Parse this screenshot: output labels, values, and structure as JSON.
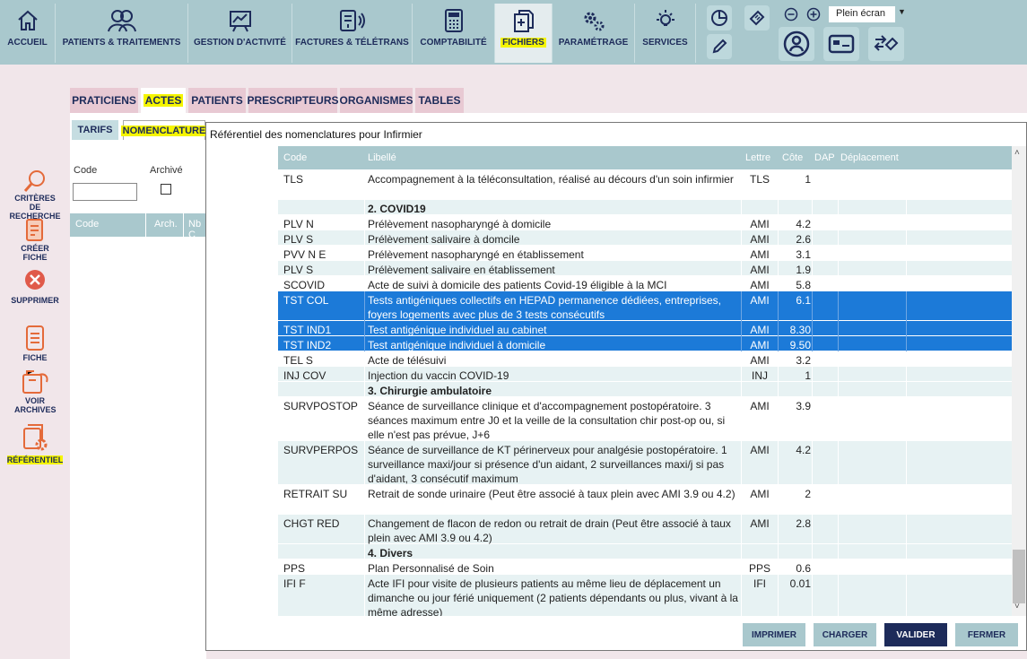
{
  "nav": {
    "items": [
      {
        "label": "ACCUEIL",
        "icon": "home-icon"
      },
      {
        "label": "PATIENTS & TRAITEMENTS",
        "icon": "users-icon"
      },
      {
        "label": "GESTION D'ACTIVITÉ",
        "icon": "chart-board-icon"
      },
      {
        "label": "FACTURES & TÉLÉTRANS",
        "icon": "invoice-transmit-icon"
      },
      {
        "label": "COMPTABILITÉ",
        "icon": "calculator-icon"
      },
      {
        "label": "FICHIERS",
        "icon": "files-icon"
      },
      {
        "label": "PARAMÉTRAGE",
        "icon": "gears-icon"
      },
      {
        "label": "SERVICES",
        "icon": "bulb-icon"
      }
    ],
    "fullscreen": "Plein écran"
  },
  "tabs": [
    "PRATICIENS",
    "ACTES",
    "PATIENTS",
    "PRESCRIPTEURS",
    "ORGANISMES",
    "TABLES"
  ],
  "subtabs": [
    "TARIFS",
    "NOMENCLATURE"
  ],
  "sidebar": [
    {
      "label": "CRITÈRES DE RECHERCHE",
      "icon": "search-icon"
    },
    {
      "label": "CRÉER FICHE",
      "icon": "new-file-icon"
    },
    {
      "label": "SUPPRIMER",
      "icon": "delete-icon"
    },
    {
      "label": "FICHE",
      "icon": "document-icon"
    },
    {
      "label": "VOIR ARCHIVES",
      "icon": "archive-icon"
    },
    {
      "label": "RÉFÉRENTIEL",
      "icon": "referential-icon"
    }
  ],
  "leftpanel": {
    "code_label": "Code",
    "archive_label": "Archivé",
    "columns": [
      "Code",
      "Arch.",
      "Nb C"
    ]
  },
  "modal": {
    "title": "Référentiel des nomenclatures pour Infirmier",
    "columns": [
      "Code",
      "Libellé",
      "Lettre",
      "Côte",
      "DAP",
      "Déplacement"
    ],
    "rows": [
      {
        "code": "TLS",
        "libelle": "Accompagnement à la téléconsultation, réalisé au décours d'un soin infirmier",
        "lettre": "TLS",
        "cote": "1",
        "type": "odd"
      },
      {
        "code": "",
        "libelle": "2. COVID19",
        "lettre": "",
        "cote": "",
        "type": "group"
      },
      {
        "code": "PLV N",
        "libelle": "Prélèvement nasopharyngé à domicile",
        "lettre": "AMI",
        "cote": "4.2",
        "type": "odd"
      },
      {
        "code": "PLV S",
        "libelle": "Prélèvement salivaire à domcile",
        "lettre": "AMI",
        "cote": "2.6",
        "type": "even"
      },
      {
        "code": "PVV N E",
        "libelle": "Prélèvement nasopharyngé en établissement",
        "lettre": "AMI",
        "cote": "3.1",
        "type": "odd"
      },
      {
        "code": "PLV S",
        "libelle": "Prélèvement salivaire en établissement",
        "lettre": "AMI",
        "cote": "1.9",
        "type": "even"
      },
      {
        "code": "SCOVID",
        "libelle": "Acte de suivi à domicile des patients Covid-19 éligible à la MCI",
        "lettre": "AMI",
        "cote": "5.8",
        "type": "odd"
      },
      {
        "code": "TST COL",
        "libelle": "Tests antigéniques collectifs en HEPAD permanence dédiées, entreprises, foyers logements avec plus de 3 tests consécutifs",
        "lettre": "AMI",
        "cote": "6.1",
        "type": "sel"
      },
      {
        "code": "TST IND1",
        "libelle": "Test antigénique individuel au cabinet",
        "lettre": "AMI",
        "cote": "8.30",
        "type": "sel"
      },
      {
        "code": "TST IND2",
        "libelle": "Test antigénique individuel à domicile",
        "lettre": "AMI",
        "cote": "9.50",
        "type": "sel"
      },
      {
        "code": "TEL S",
        "libelle": "Acte de télésuivi",
        "lettre": "AMI",
        "cote": "3.2",
        "type": "odd"
      },
      {
        "code": "INJ COV",
        "libelle": "Injection du vaccin COVID-19",
        "lettre": "INJ",
        "cote": "1",
        "type": "even"
      },
      {
        "code": "",
        "libelle": "3. Chirurgie ambulatoire",
        "lettre": "",
        "cote": "",
        "type": "group"
      },
      {
        "code": "SURVPOSTOP",
        "libelle": "Séance de surveillance clinique et d'accompagnement postopératoire. 3 séances maximum entre J0 et la veille de la consultation chir post-op ou, si elle n'est pas prévue, J+6",
        "lettre": "AMI",
        "cote": "3.9",
        "type": "odd"
      },
      {
        "code": "SURVPERPOS",
        "libelle": "Séance de surveillance de KT périnerveux pour analgésie postopératoire. 1 surveillance maxi/jour si présence d'un aidant, 2 surveillances maxi/j si pas d'aidant, 3 consécutif maximum",
        "lettre": "AMI",
        "cote": "4.2",
        "type": "even"
      },
      {
        "code": "RETRAIT SU",
        "libelle": "Retrait de sonde urinaire (Peut être associé à taux plein avec AMI 3.9 ou 4.2)",
        "lettre": "AMI",
        "cote": "2",
        "type": "odd"
      },
      {
        "code": "CHGT RED",
        "libelle": "Changement de flacon de redon ou retrait de drain (Peut être associé à taux plein avec AMI 3.9 ou 4.2)",
        "lettre": "AMI",
        "cote": "2.8",
        "type": "even"
      },
      {
        "code": "",
        "libelle": "4. Divers",
        "lettre": "",
        "cote": "",
        "type": "group"
      },
      {
        "code": "PPS",
        "libelle": "Plan Personnalisé de Soin",
        "lettre": "PPS",
        "cote": "0.6",
        "type": "odd"
      },
      {
        "code": "IFI F",
        "libelle": "Acte IFI pour visite de plusieurs patients au même lieu de déplacement un dimanche ou jour férié uniquement (2 patients dépendants ou plus, vivant à la même adresse)",
        "lettre": "IFI",
        "cote": "0.01",
        "type": "even"
      }
    ],
    "buttons": [
      "IMPRIMER",
      "CHARGER",
      "VALIDER",
      "FERMER"
    ]
  }
}
